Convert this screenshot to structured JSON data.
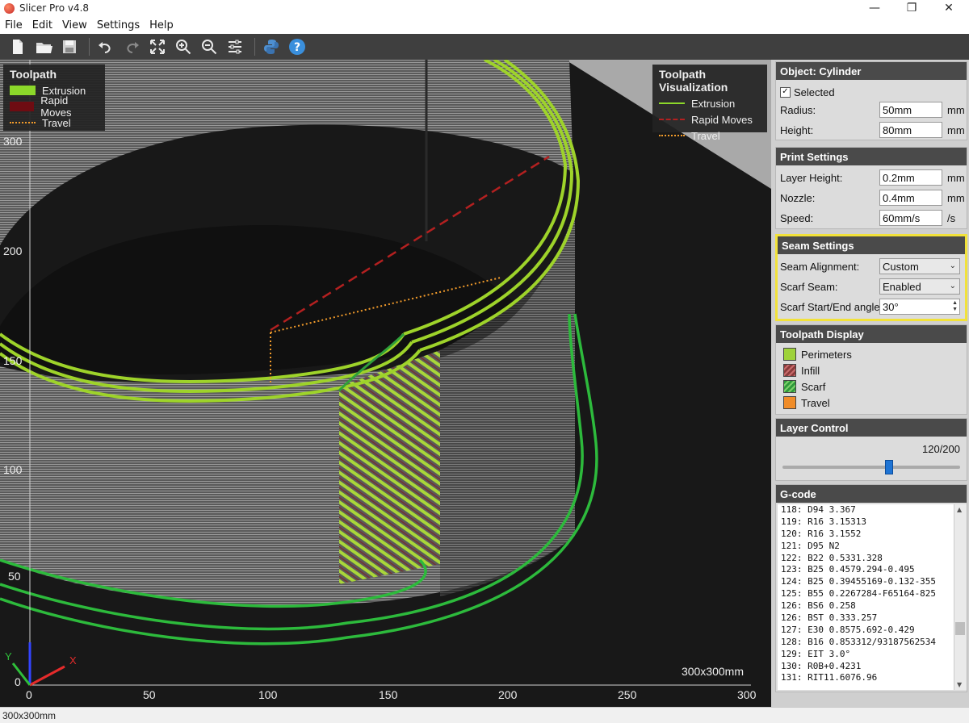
{
  "window": {
    "title": "Slicer Pro v4.8"
  },
  "menu": [
    "File",
    "Edit",
    "View",
    "Settings",
    "Help"
  ],
  "toolbar": {
    "icons": [
      "new-file-icon",
      "open-folder-icon",
      "save-icon",
      "undo-icon",
      "redo-icon",
      "fit-view-icon",
      "zoom-in-icon",
      "zoom-out-icon",
      "settings-sliders-icon",
      "python-icon",
      "help-icon"
    ]
  },
  "viewport": {
    "legend_left": {
      "title": "Toolpath",
      "items": [
        {
          "label": "Extrusion",
          "color": "#8cd82a"
        },
        {
          "label": "Rapid Moves",
          "color": "#6e0c12"
        },
        {
          "label": "Travel",
          "color": "#f39c2b"
        }
      ]
    },
    "legend_right": {
      "title": "Toolpath Visualization",
      "items": [
        {
          "label": "Extrusion",
          "color": "#8cd82a"
        },
        {
          "label": "Rapid Moves",
          "color": "#b32020"
        },
        {
          "label": "Travel",
          "color": "#f39c2b"
        }
      ]
    },
    "y_ticks": [
      "300",
      "200",
      "150",
      "100",
      "50",
      "0"
    ],
    "x_ticks": [
      "0",
      "50",
      "100",
      "150",
      "200",
      "250",
      "300"
    ],
    "bed_size": "300x300mm",
    "axis_x": "X",
    "axis_y": "Y"
  },
  "object": {
    "title": "Object: Cylinder",
    "selected_label": "Selected",
    "selected": true,
    "radius_label": "Radius:",
    "radius_value": "50mm",
    "radius_unit": "mm",
    "height_label": "Height:",
    "height_value": "80mm",
    "height_unit": "mm"
  },
  "print": {
    "title": "Print Settings",
    "layer_label": "Layer Height:",
    "layer_value": "0.2mm",
    "layer_unit": "mm",
    "nozzle_label": "Nozzle:",
    "nozzle_value": "0.4mm",
    "nozzle_unit": "mm",
    "speed_label": "Speed:",
    "speed_value": "60mm/s",
    "speed_unit": "/s"
  },
  "seam": {
    "title": "Seam Settings",
    "alignment_label": "Seam Alignment:",
    "alignment_value": "Custom",
    "scarf_label": "Scarf Seam:",
    "scarf_value": "Enabled",
    "angle_label": "Scarf Start/End angle:",
    "angle_value": "30°",
    "highlight": "#f2e23a"
  },
  "display": {
    "title": "Toolpath Display",
    "items": [
      {
        "label": "Perimeters",
        "color": "#9ed23a"
      },
      {
        "label": "Infill",
        "color": "#8a3a3a"
      },
      {
        "label": "Scarf",
        "color": "#2f9a3a"
      },
      {
        "label": "Travel",
        "color": "#f08c28"
      }
    ]
  },
  "layer": {
    "title": "Layer Control",
    "readout": "120/200",
    "current": 120,
    "max": 200
  },
  "gcode": {
    "title": "G-code",
    "lines": [
      "118: D94 3.367",
      "119: R16 3.15313",
      "120: R16 3.1552",
      "121: D95 N2",
      "122: B22 0.5331.328",
      "123: B25 0.4579.294-0.495",
      "124: B25 0.39455169-0.132-355",
      "125: B55 0.2267284-F65164-825",
      "126: BS6 0.258",
      "126: BST 0.333.257",
      "127: E30 0.8575.692-0.429",
      "128: B16 0.853312/93187562534",
      "129: EIT 3.0°",
      "130: R0B+0.4231",
      "131: RIT11.6076.96"
    ]
  },
  "status": {
    "text": "300x300mm"
  }
}
